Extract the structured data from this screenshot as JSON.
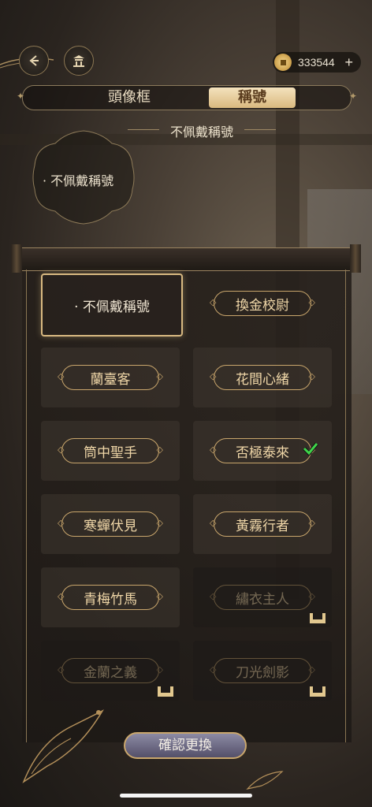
{
  "header": {
    "currency_value": "333544",
    "plus_label": "+"
  },
  "tabs": [
    {
      "label": "頭像框",
      "active": false
    },
    {
      "label": "稱號",
      "active": true
    }
  ],
  "current": {
    "title_label": "不佩戴稱號",
    "preview_label": "· 不佩戴稱號"
  },
  "titles": [
    {
      "label": "· 不佩戴稱號",
      "selected": true,
      "locked": false,
      "equipped": false
    },
    {
      "label": "換金校尉",
      "selected": false,
      "locked": false,
      "equipped": false
    },
    {
      "label": "蘭臺客",
      "selected": false,
      "locked": false,
      "equipped": false
    },
    {
      "label": "花間心緒",
      "selected": false,
      "locked": false,
      "equipped": false
    },
    {
      "label": "筒中聖手",
      "selected": false,
      "locked": false,
      "equipped": false
    },
    {
      "label": "否極泰來",
      "selected": false,
      "locked": false,
      "equipped": true
    },
    {
      "label": "寒蟬伏見",
      "selected": false,
      "locked": false,
      "equipped": false
    },
    {
      "label": "黃霧行者",
      "selected": false,
      "locked": false,
      "equipped": false
    },
    {
      "label": "青梅竹馬",
      "selected": false,
      "locked": false,
      "equipped": false
    },
    {
      "label": "繡衣主人",
      "selected": false,
      "locked": true,
      "equipped": false
    },
    {
      "label": "金蘭之義",
      "selected": false,
      "locked": true,
      "equipped": false
    },
    {
      "label": "刀光劍影",
      "selected": false,
      "locked": true,
      "equipped": false
    }
  ],
  "confirm_label": "確認更換",
  "colors": {
    "accent_gold": "#c9a66c",
    "tab_active_bg": "#f4e2bd",
    "check_green": "#3fd44a"
  },
  "icons": [
    "back-arrow-icon",
    "pavilion-icon",
    "coin-icon",
    "plus-icon",
    "checkmark-icon",
    "lock-icon"
  ]
}
